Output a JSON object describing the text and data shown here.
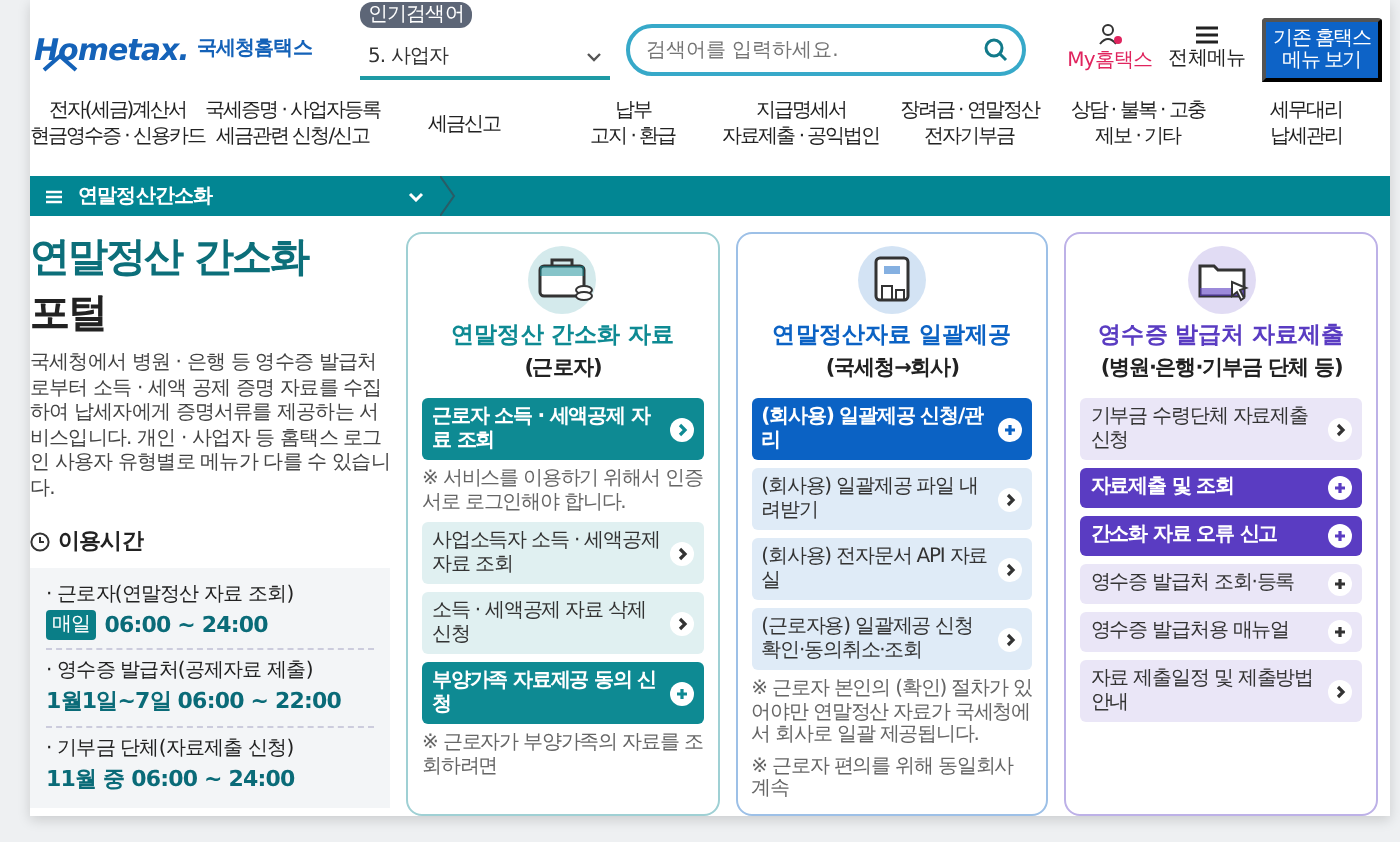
{
  "header": {
    "logo": {
      "brand": "Hometax.",
      "name": "국세청홈택스"
    },
    "popular_badge": "인기검색어",
    "popular_select": "5. 사업자",
    "search": {
      "placeholder": "검색어를 입력하세요."
    },
    "my_link": "My홈택스",
    "all_menu": "전체메뉴",
    "legacy_button": [
      "기존 홈택스",
      "메뉴 보기"
    ]
  },
  "nav": [
    {
      "lines": [
        "전자(세금)계산서",
        "현금영수증 · 신용카드"
      ]
    },
    {
      "lines": [
        "국세증명 · 사업자등록",
        "세금관련 신청/신고"
      ]
    },
    {
      "lines": [
        "세금신고"
      ]
    },
    {
      "lines": [
        "납부",
        "고지 · 환급"
      ]
    },
    {
      "lines": [
        "지급명세서",
        "자료제출 · 공익법인"
      ]
    },
    {
      "lines": [
        "장려금 · 연말정산",
        "전자기부금"
      ]
    },
    {
      "lines": [
        "상담 · 불복 · 고충",
        "제보 · 기타"
      ]
    },
    {
      "lines": [
        "세무대리",
        "납세관리"
      ]
    }
  ],
  "breadcrumb": "연말정산간소화",
  "intro": {
    "title": "연말정산 간소화",
    "title_2": "포털",
    "description": "국세청에서 병원 · 은행 등 영수증 발급처로부터 소득 · 세액 공제 증명 자료를 수집하여 납세자에게 증명서류를 제공하는 서비스입니다. 개인 · 사업자 등 홈택스 로그인 사용자 유형별로 메뉴가 다를 수 있습니다.",
    "hours_title": "이용시간",
    "hours": [
      {
        "label": "· 근로자(연말정산 자료 조회)",
        "badge": "매일",
        "time": "06:00 ~ 24:00"
      },
      {
        "label": "· 영수증 발급처(공제자료 제출)",
        "time": "1월1일~7일 06:00 ~ 22:00"
      },
      {
        "label": "· 기부금 단체(자료제출 신청)",
        "time": "11월 중 06:00 ~ 24:00"
      }
    ]
  },
  "cards": [
    {
      "kind": "briefcase",
      "color": "#0e8a93",
      "title": "연말정산 간소화 자료",
      "subtitle": "(근로자)",
      "items": [
        {
          "kind": "primary",
          "expandable": false,
          "text": "근로자 소득 · 세액공제 자료 조회"
        },
        {
          "kind": "note",
          "text": "※ 서비스를 이용하기 위해서 인증서로 로그인해야 합니다."
        },
        {
          "kind": "secondary",
          "expandable": false,
          "text": "사업소득자 소득 · 세액공제 자료 조회"
        },
        {
          "kind": "secondary",
          "expandable": false,
          "text": "소득 · 세액공제 자료 삭제 신청"
        },
        {
          "kind": "primary",
          "expandable": true,
          "text": "부양가족 자료제공 동의 신청"
        },
        {
          "kind": "note",
          "text": "※ 근로자가 부양가족의 자료를 조회하려면"
        }
      ]
    },
    {
      "kind": "building",
      "color": "#0b62c4",
      "title": "연말정산자료 일괄제공",
      "subtitle": "(국세청→회사)",
      "items": [
        {
          "kind": "primary",
          "expandable": true,
          "text": "(회사용) 일괄제공 신청/관리"
        },
        {
          "kind": "secondary",
          "expandable": false,
          "text": "(회사용) 일괄제공 파일 내려받기"
        },
        {
          "kind": "secondary",
          "expandable": false,
          "text": "(회사용) 전자문서 API 자료실"
        },
        {
          "kind": "secondary",
          "expandable": false,
          "text": "(근로자용) 일괄제공 신청확인·동의취소·조회"
        },
        {
          "kind": "note",
          "text": "※ 근로자 본인의 (확인) 절차가 있어야만 연말정산 자료가 국세청에서 회사로 일괄 제공됩니다."
        },
        {
          "kind": "note",
          "text": "※ 근로자 편의를 위해 동일회사 계속"
        }
      ]
    },
    {
      "kind": "folder",
      "color": "#5a3cc2",
      "title": "영수증 발급처 자료제출",
      "subtitle": "(병원·은행·기부금 단체 등)",
      "items": [
        {
          "kind": "secondary",
          "expandable": false,
          "text": "기부금 수령단체 자료제출 신청"
        },
        {
          "kind": "primary",
          "expandable": true,
          "text": "자료제출 및 조회"
        },
        {
          "kind": "primary",
          "expandable": true,
          "text": "간소화 자료 오류 신고"
        },
        {
          "kind": "secondary",
          "expandable": true,
          "text": "영수증 발급처 조회·등록"
        },
        {
          "kind": "secondary",
          "expandable": true,
          "text": "영수증 발급처용 매뉴얼"
        },
        {
          "kind": "secondary",
          "expandable": false,
          "text": "자료 제출일정 및 제출방법 안내"
        }
      ]
    }
  ]
}
